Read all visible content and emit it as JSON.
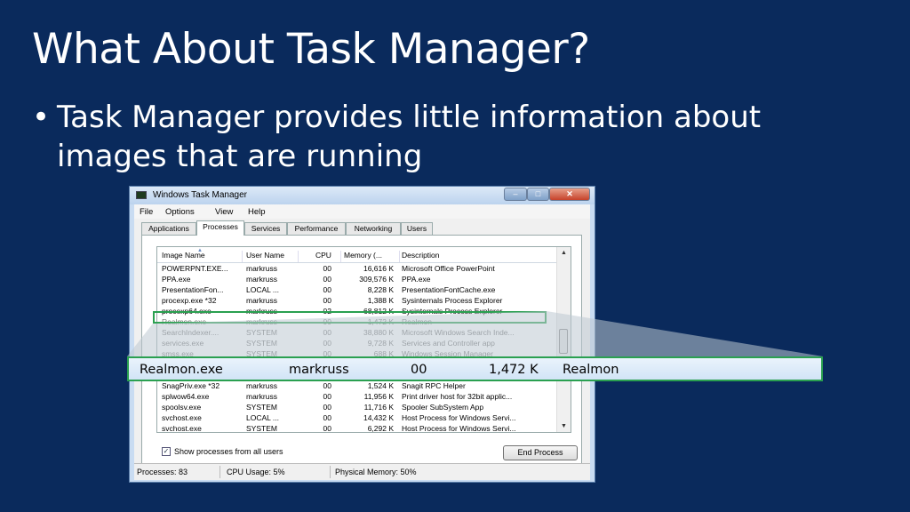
{
  "slide": {
    "title": "What About Task Manager?",
    "bullet_marker": "•",
    "bullet_text": "Task Manager provides little information about images that are running"
  },
  "window": {
    "title": "Windows Task Manager",
    "menu": [
      "File",
      "Options",
      "View",
      "Help"
    ],
    "tabs": [
      "Applications",
      "Processes",
      "Services",
      "Performance",
      "Networking",
      "Users"
    ],
    "active_tab": "Processes",
    "columns": [
      "Image Name",
      "User Name",
      "CPU",
      "Memory (...",
      "Description"
    ],
    "rows_top": [
      [
        "POWERPNT.EXE...",
        "markruss",
        "00",
        "16,616 K",
        "Microsoft Office PowerPoint"
      ],
      [
        "PPA.exe",
        "markruss",
        "00",
        "309,576 K",
        "PPA.exe"
      ],
      [
        "PresentationFon...",
        "LOCAL ...",
        "00",
        "8,228 K",
        "PresentationFontCache.exe"
      ],
      [
        "procexp.exe *32",
        "markruss",
        "00",
        "1,388 K",
        "Sysinternals Process Explorer"
      ],
      [
        "procexp64.exe",
        "markruss",
        "02",
        "68,812 K",
        "Sysinternals Process Explorer"
      ],
      [
        "Realmon.exe",
        "markruss",
        "00",
        "1,472 K",
        "Realmon"
      ],
      [
        "SearchIndexer....",
        "SYSTEM",
        "00",
        "38,880 K",
        "Microsoft Windows Search Inde..."
      ],
      [
        "services.exe",
        "SYSTEM",
        "00",
        "9,728 K",
        "Services and Controller app"
      ],
      [
        "smss.exe",
        "SYSTEM",
        "00",
        "688 K",
        "Windows Session Manager"
      ]
    ],
    "rows_bottom": [
      [
        "SnagPriv.exe *32",
        "markruss",
        "00",
        "1,524 K",
        "Snagit RPC Helper"
      ],
      [
        "splwow64.exe",
        "markruss",
        "00",
        "11,956 K",
        "Print driver host for 32bit applic..."
      ],
      [
        "spoolsv.exe",
        "SYSTEM",
        "00",
        "11,716 K",
        "Spooler SubSystem App"
      ],
      [
        "svchost.exe",
        "LOCAL ...",
        "00",
        "14,432 K",
        "Host Process for Windows Servi..."
      ],
      [
        "svchost.exe",
        "SYSTEM",
        "00",
        "6,292 K",
        "Host Process for Windows Servi..."
      ]
    ],
    "show_all_label": "Show processes from all users",
    "show_all_checked": true,
    "end_process_label": "End Process",
    "status": {
      "processes": "Processes: 83",
      "cpu": "CPU Usage: 5%",
      "memory": "Physical Memory: 50%"
    }
  },
  "zoom": {
    "name": "Realmon.exe",
    "user": "markruss",
    "cpu": "00",
    "memory": "1,472 K",
    "description": "Realmon"
  },
  "colors": {
    "background": "#0a2a5c",
    "highlight": "#2aa050"
  }
}
